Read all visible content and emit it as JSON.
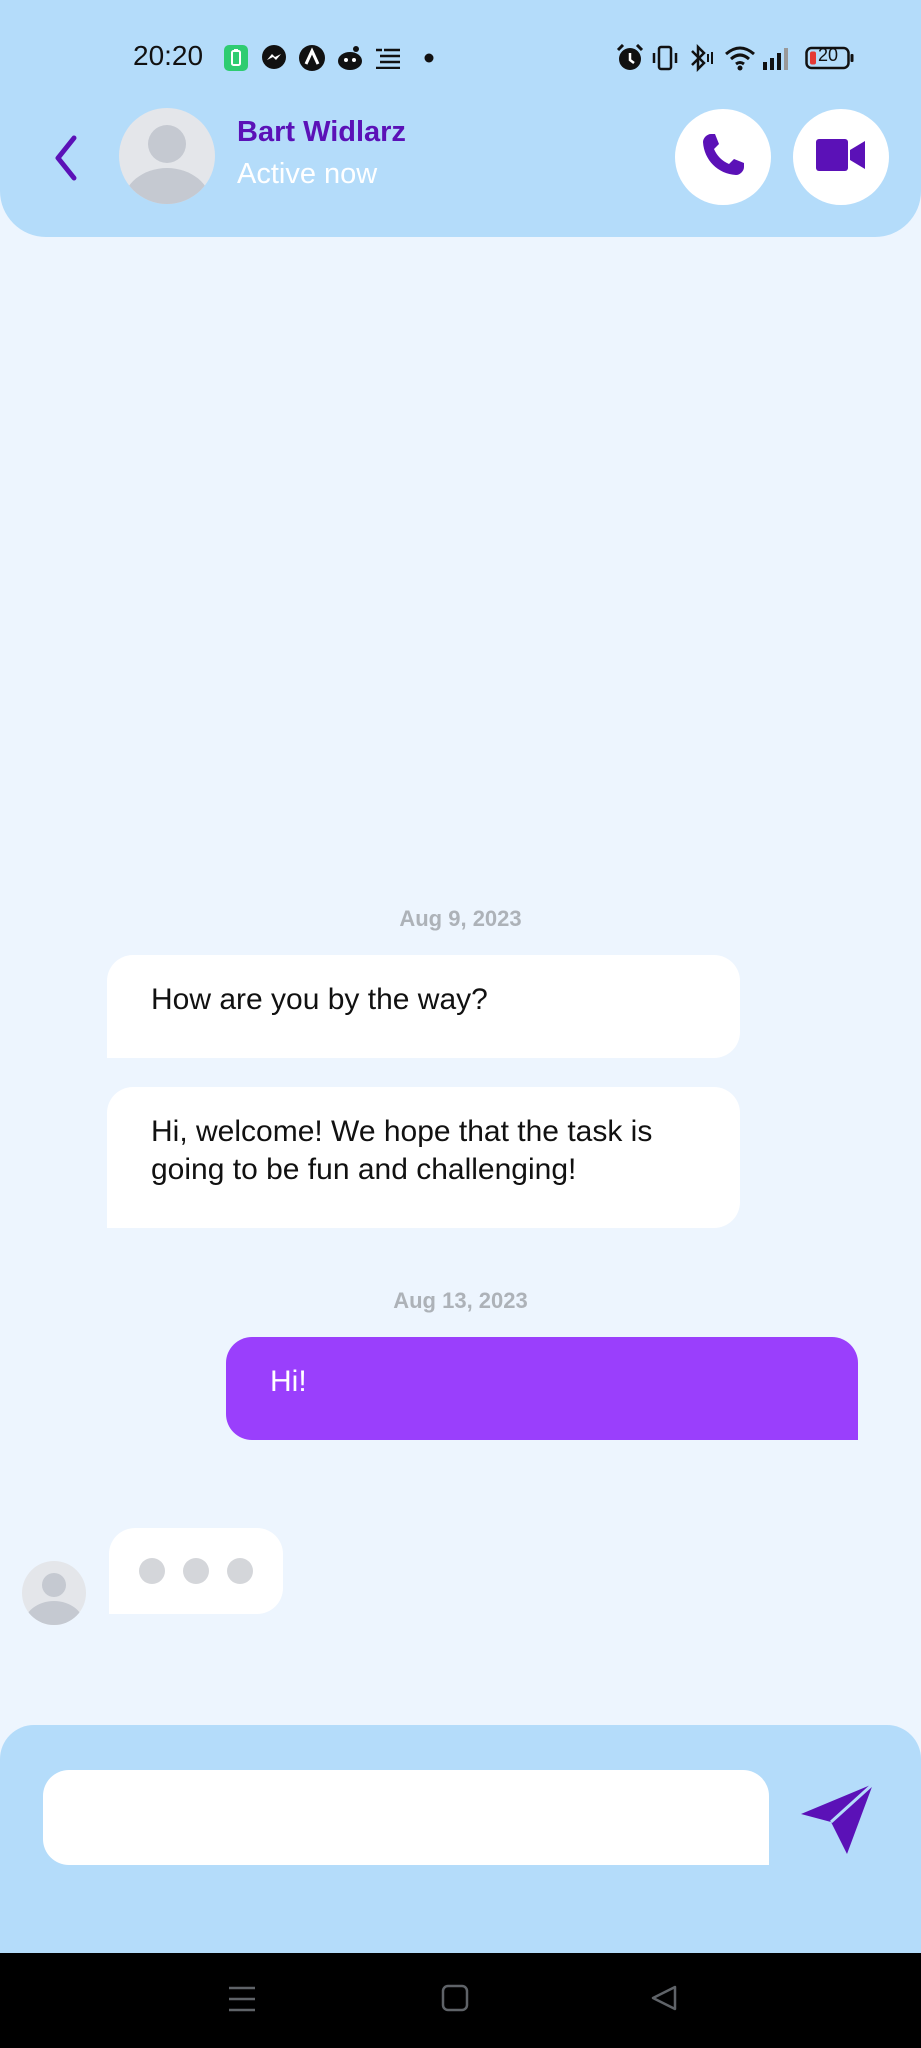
{
  "status_bar": {
    "time": "20:20",
    "battery_level": "20",
    "notification_icons": [
      "battery-saver-icon",
      "messenger-icon",
      "arc-app-icon",
      "reddit-icon",
      "news-feed-icon",
      "more-dot-icon"
    ],
    "system_icons": [
      "alarm-icon",
      "vibrate-icon",
      "bluetooth-icon",
      "wifi-icon",
      "signal-icon",
      "battery-icon"
    ]
  },
  "header": {
    "contact_name": "Bart Widlarz",
    "presence": "Active now",
    "accent_color": "#5b11b7",
    "background_color": "#b4dcfa"
  },
  "conversation": {
    "groups": [
      {
        "date": "Aug 9, 2023",
        "messages": [
          {
            "direction": "incoming",
            "text": "How are you by the way?"
          },
          {
            "direction": "incoming",
            "text": "Hi, welcome! We hope that the task is going to be fun and challenging!"
          }
        ]
      },
      {
        "date": "Aug 13, 2023",
        "messages": [
          {
            "direction": "outgoing",
            "text": "Hi!"
          }
        ]
      }
    ],
    "typing_indicator": true,
    "outgoing_color": "#9a3ffc"
  },
  "composer": {
    "input_value": "",
    "placeholder": ""
  }
}
